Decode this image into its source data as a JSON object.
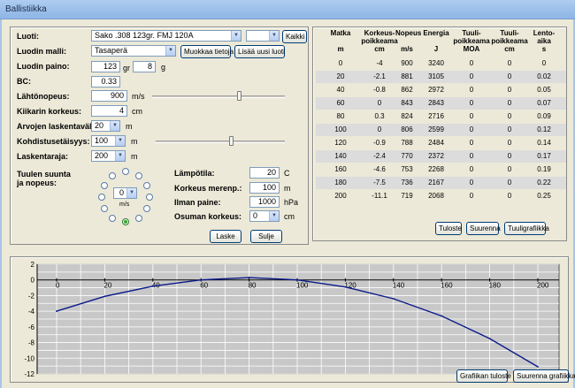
{
  "window": {
    "title": "Ballistiikka"
  },
  "form": {
    "bullet_label": "Luoti:",
    "bullet_value": "Sako .308 123gr. FMJ  120A",
    "bullet_filter_value": "",
    "all_button": "Kaikki",
    "model_label": "Luodin malli:",
    "model_value": "Tasaperä",
    "edit_button": "Muokkaa tietoja",
    "add_button": "Lisää uusi luoti",
    "weight_label": "Luodin paino:",
    "weight_gr": "123",
    "weight_gr_unit": "gr",
    "weight_g": "8",
    "weight_g_unit": "g",
    "bc_label": "BC:",
    "bc_value": "0.33",
    "velocity_label": "Lähtönopeus:",
    "velocity_value": "900",
    "velocity_unit": "m/s",
    "scope_label": "Kiikarin korkeus:",
    "scope_value": "4",
    "scope_unit": "cm",
    "interval_label": "Arvojen laskentaväli:",
    "interval_value": "20",
    "interval_unit": "m",
    "zero_label": "Kohdistusetäisyys:",
    "zero_value": "100",
    "zero_unit": "m",
    "limit_label": "Laskentaraja:",
    "limit_value": "200",
    "limit_unit": "m",
    "wind_label_1": "Tuulen suunta",
    "wind_label_2": "ja nopeus:",
    "wind_speed_value": "0",
    "wind_speed_unit": "m/s",
    "temp_label": "Lämpötila:",
    "temp_value": "20",
    "temp_unit": "C",
    "alt_label": "Korkeus merenp.:",
    "alt_value": "100",
    "alt_unit": "m",
    "pressure_label": "Ilman paine:",
    "pressure_value": "1000",
    "pressure_unit": "hPa",
    "impact_label": "Osuman korkeus:",
    "impact_value": "0",
    "impact_unit": "cm",
    "calc_button": "Laske",
    "close_button": "Sulje"
  },
  "table": {
    "headers": [
      {
        "l1": "Matka",
        "l2": "",
        "unit": "m"
      },
      {
        "l1": "Korkeus-",
        "l2": "poikkeama",
        "unit": "cm"
      },
      {
        "l1": "Nopeus",
        "l2": "",
        "unit": "m/s"
      },
      {
        "l1": "Energia",
        "l2": "",
        "unit": "J"
      },
      {
        "l1": "Tuuli-",
        "l2": "poikkeama",
        "unit": "MOA"
      },
      {
        "l1": "Tuuli-",
        "l2": "poikkeama",
        "unit": "cm"
      },
      {
        "l1": "Lento-",
        "l2": "aika",
        "unit": "s"
      }
    ],
    "rows": [
      [
        "0",
        "-4",
        "900",
        "3240",
        "0",
        "0",
        "0"
      ],
      [
        "20",
        "-2.1",
        "881",
        "3105",
        "0",
        "0",
        "0.02"
      ],
      [
        "40",
        "-0.8",
        "862",
        "2972",
        "0",
        "0",
        "0.05"
      ],
      [
        "60",
        "0",
        "843",
        "2843",
        "0",
        "0",
        "0.07"
      ],
      [
        "80",
        "0.3",
        "824",
        "2716",
        "0",
        "0",
        "0.09"
      ],
      [
        "100",
        "0",
        "806",
        "2599",
        "0",
        "0",
        "0.12"
      ],
      [
        "120",
        "-0.9",
        "788",
        "2484",
        "0",
        "0",
        "0.14"
      ],
      [
        "140",
        "-2.4",
        "770",
        "2372",
        "0",
        "0",
        "0.17"
      ],
      [
        "160",
        "-4.6",
        "753",
        "2268",
        "0",
        "0",
        "0.19"
      ],
      [
        "180",
        "-7.5",
        "736",
        "2167",
        "0",
        "0",
        "0.22"
      ],
      [
        "200",
        "-11.1",
        "719",
        "2068",
        "0",
        "0",
        "0.25"
      ]
    ],
    "print_button": "Tuloste",
    "enlarge_button": "Suurenna",
    "wind_graph_button": "Tuuligrafiikka"
  },
  "chart_actions": {
    "print_chart_button": "Grafiikan tuloste",
    "enlarge_chart_button": "Suurenna grafiikka"
  },
  "chart_data": {
    "type": "line",
    "x": [
      0,
      20,
      40,
      60,
      80,
      100,
      120,
      140,
      160,
      180,
      200
    ],
    "series": [
      {
        "values": [
          -4,
          -2.1,
          -0.8,
          0,
          0.3,
          0,
          -0.9,
          -2.4,
          -4.6,
          -7.5,
          -11.1
        ]
      }
    ],
    "xticks": [
      0,
      20,
      40,
      60,
      80,
      100,
      120,
      140,
      160,
      180,
      200
    ],
    "yticks": [
      2,
      0,
      -2,
      -4,
      -6,
      -8,
      -10,
      -12
    ],
    "xlim": [
      0,
      200
    ],
    "ylim": [
      -12,
      2
    ],
    "grid": true,
    "line_color": "#0a1a8a",
    "title": "",
    "xlabel": "",
    "ylabel": ""
  }
}
